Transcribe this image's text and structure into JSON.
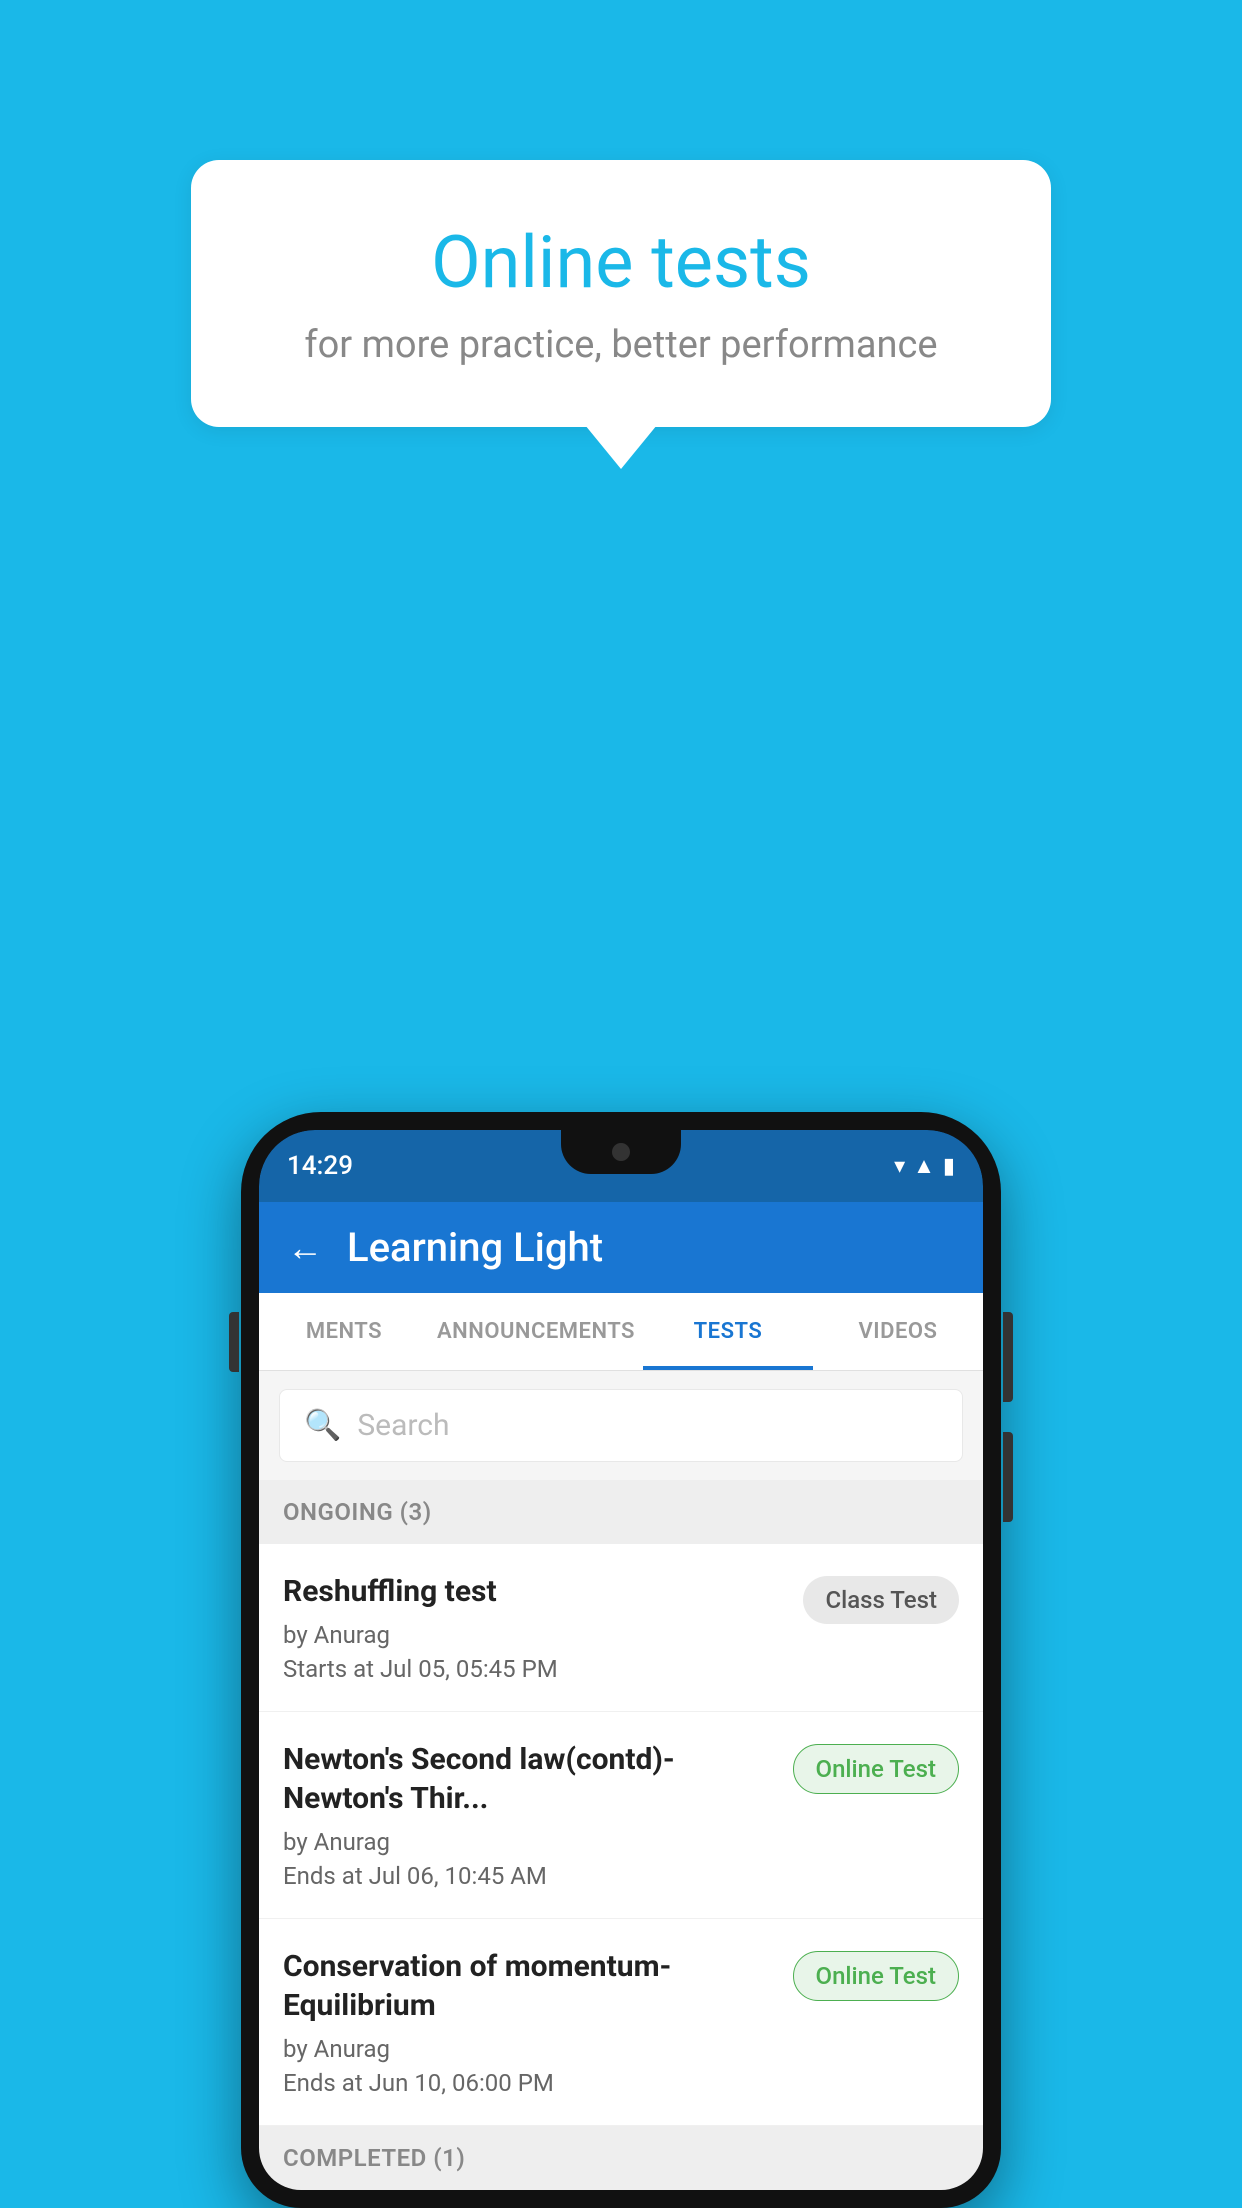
{
  "background_color": "#1ab8e8",
  "bubble": {
    "title": "Online tests",
    "subtitle": "for more practice, better performance"
  },
  "phone": {
    "status_bar": {
      "time": "14:29",
      "icons": [
        "wifi",
        "signal",
        "battery"
      ]
    },
    "header": {
      "back_label": "←",
      "title": "Learning Light"
    },
    "tabs": [
      {
        "label": "MENTS",
        "active": false
      },
      {
        "label": "ANNOUNCEMENTS",
        "active": false
      },
      {
        "label": "TESTS",
        "active": true
      },
      {
        "label": "VIDEOS",
        "active": false
      }
    ],
    "search": {
      "placeholder": "Search"
    },
    "sections": [
      {
        "title": "ONGOING (3)",
        "tests": [
          {
            "name": "Reshuffling test",
            "author": "by Anurag",
            "time_label": "Starts at",
            "time": "Jul 05, 05:45 PM",
            "badge": "Class Test",
            "badge_type": "class"
          },
          {
            "name": "Newton's Second law(contd)-Newton's Thir...",
            "author": "by Anurag",
            "time_label": "Ends at",
            "time": "Jul 06, 10:45 AM",
            "badge": "Online Test",
            "badge_type": "online"
          },
          {
            "name": "Conservation of momentum-Equilibrium",
            "author": "by Anurag",
            "time_label": "Ends at",
            "time": "Jun 10, 06:00 PM",
            "badge": "Online Test",
            "badge_type": "online"
          }
        ]
      },
      {
        "title": "COMPLETED (1)",
        "tests": []
      }
    ]
  }
}
